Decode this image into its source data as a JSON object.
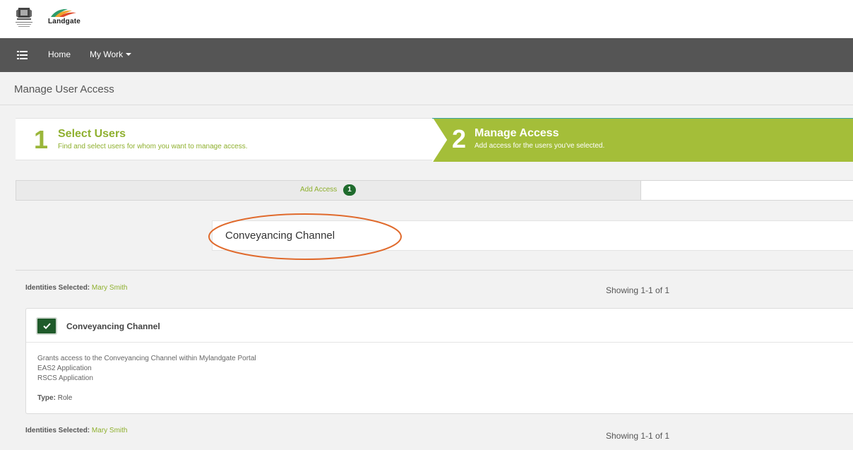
{
  "header": {
    "logo_text": "Landgate"
  },
  "navbar": {
    "menu_icon": "list-icon",
    "home": "Home",
    "my_work": "My Work"
  },
  "page": {
    "title": "Manage User Access"
  },
  "wizard": {
    "step1": {
      "number": "1",
      "title": "Select Users",
      "description": "Find and select users for whom you want to manage access."
    },
    "step2": {
      "number": "2",
      "title": "Manage Access",
      "description": "Add access for the users you've selected."
    }
  },
  "tabs": {
    "add_access_label": "Add Access",
    "add_access_count": "1"
  },
  "search": {
    "value": "Conveyancing Channel"
  },
  "results": [
    {
      "identities_label": "Identities Selected:",
      "identities_value": "Mary Smith",
      "showing": "Showing 1-1 of 1"
    },
    {
      "identities_label": "Identities Selected:",
      "identities_value": "Mary Smith",
      "showing": "Showing 1-1 of 1"
    }
  ],
  "card": {
    "title": "Conveyancing Channel",
    "checked": true,
    "description": "Grants access to the Conveyancing Channel within Mylandgate Portal",
    "items": [
      "EAS2 Application",
      "RSCS Application"
    ],
    "type_label": "Type:",
    "type_value": "Role"
  },
  "colors": {
    "navbar": "#555555",
    "accent_green": "#a4be39",
    "badge_green": "#1f6b2d",
    "highlight_ellipse": "#e06a2c"
  }
}
